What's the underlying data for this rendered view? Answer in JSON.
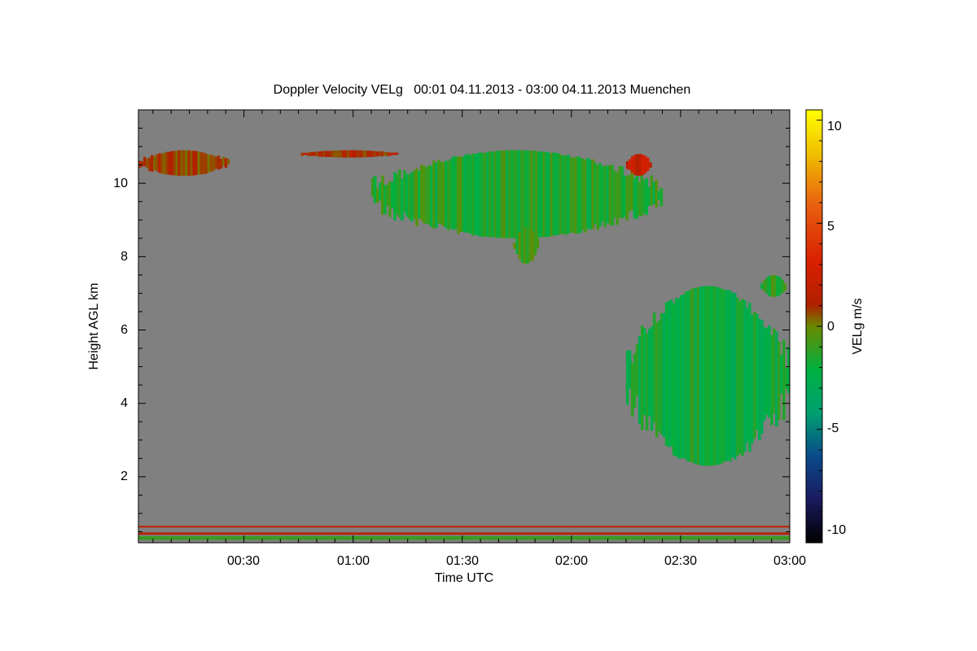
{
  "chart_data": {
    "type": "heatmap",
    "title": "Doppler Velocity VELg   00:01 04.11.2013 - 03:00 04.11.2013 Muenchen",
    "xlabel": "Time UTC",
    "ylabel": "Height AGL km",
    "xlim": [
      "00:01",
      "03:00"
    ],
    "ylim": [
      0.2,
      12.0
    ],
    "x_ticks": [
      "00:30",
      "01:00",
      "01:30",
      "02:00",
      "02:30",
      "03:00"
    ],
    "y_ticks": [
      "2",
      "4",
      "6",
      "8",
      "10"
    ],
    "colorbar": {
      "label": "VELg m/s",
      "range": [
        -10.5,
        10.5
      ],
      "ticks": [
        "10",
        "5",
        "0",
        "-5",
        "-10"
      ],
      "colormap": [
        "#000000",
        "#1a1a5e",
        "#0a4a8a",
        "#00a070",
        "#00b040",
        "#6a8a00",
        "#b02000",
        "#d82000",
        "#e86010",
        "#f0c000",
        "#ffff00"
      ]
    },
    "background_color": "#808080",
    "features": [
      {
        "name": "cirrus layer west",
        "time": [
          "00:01",
          "00:26"
        ],
        "height_km": [
          10.2,
          10.9
        ],
        "velocity_ms": 1.5
      },
      {
        "name": "cirrus layer 01:00",
        "time": [
          "00:45",
          "01:13"
        ],
        "height_km": [
          10.7,
          10.9
        ],
        "velocity_ms": 2.0
      },
      {
        "name": "main cirrus cloud",
        "time": [
          "01:05",
          "02:25"
        ],
        "height_km": [
          8.5,
          10.9
        ],
        "velocity_ms": -1.5
      },
      {
        "name": "fall streak",
        "time": [
          "01:44",
          "01:51"
        ],
        "height_km": [
          7.8,
          8.8
        ],
        "velocity_ms": -1.0
      },
      {
        "name": "red cell 02:20",
        "time": [
          "02:15",
          "02:22"
        ],
        "height_km": [
          10.2,
          10.8
        ],
        "velocity_ms": 3.0
      },
      {
        "name": "mid-level cloud",
        "time": [
          "02:15",
          "03:00"
        ],
        "height_km": [
          2.3,
          7.2
        ],
        "velocity_ms": -2.0
      },
      {
        "name": "isolated cloud 02:55",
        "time": [
          "02:52",
          "02:59"
        ],
        "height_km": [
          6.9,
          7.5
        ],
        "velocity_ms": -1.0
      },
      {
        "name": "near-surface clutter",
        "time": [
          "00:01",
          "03:00"
        ],
        "height_km": [
          0.25,
          0.65
        ],
        "velocity_ms": 3.0
      }
    ]
  }
}
